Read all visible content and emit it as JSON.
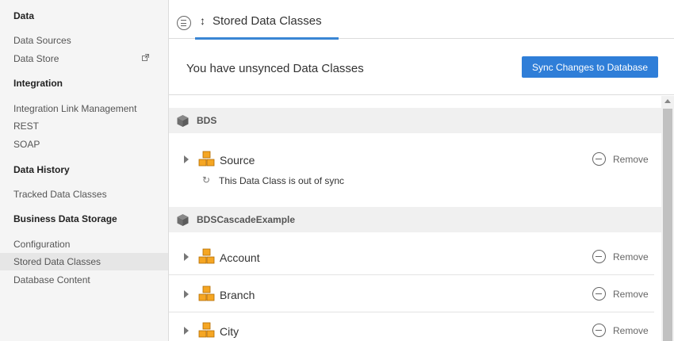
{
  "sidebar": {
    "sections": [
      {
        "title": "Data",
        "items": [
          {
            "label": "Data Sources"
          },
          {
            "label": "Data Store",
            "external": true
          }
        ]
      },
      {
        "title": "Integration",
        "items": [
          {
            "label": "Integration Link Management"
          },
          {
            "label": "REST"
          },
          {
            "label": "SOAP"
          }
        ]
      },
      {
        "title": "Data History",
        "items": [
          {
            "label": "Tracked Data Classes"
          }
        ]
      },
      {
        "title": "Business Data Storage",
        "items": [
          {
            "label": "Configuration"
          },
          {
            "label": "Stored Data Classes",
            "active": true
          },
          {
            "label": "Database Content"
          }
        ]
      }
    ]
  },
  "tab": {
    "label": "Stored Data Classes",
    "icon": "sync-icon"
  },
  "banner": {
    "message": "You have unsynced Data Classes",
    "sync_button": "Sync Changes to Database"
  },
  "groups": [
    {
      "name": "BDS",
      "icon": "cube-icon",
      "rows": [
        {
          "name": "Source",
          "remove_label": "Remove",
          "warning": "This Data Class is out of sync"
        }
      ]
    },
    {
      "name": "BDSCascadeExample",
      "icon": "cube-icon",
      "rows": [
        {
          "name": "Account",
          "remove_label": "Remove"
        },
        {
          "name": "Branch",
          "remove_label": "Remove"
        },
        {
          "name": "City",
          "remove_label": "Remove"
        }
      ]
    }
  ],
  "colors": {
    "accent": "#2f7ed8",
    "tab_underline": "#3a86d4",
    "class_icon": "#f5a623"
  }
}
